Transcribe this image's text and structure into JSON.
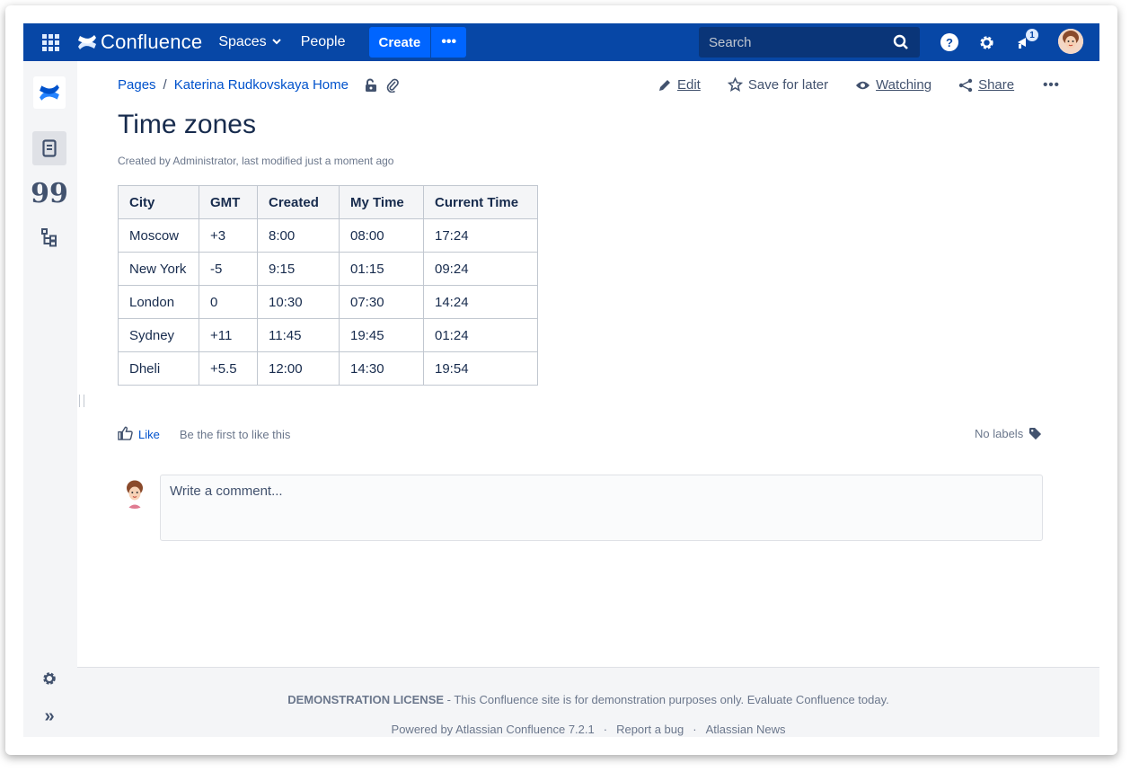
{
  "header": {
    "app_name": "Confluence",
    "nav": {
      "spaces": "Spaces",
      "people": "People"
    },
    "create_label": "Create",
    "more_label": "•••",
    "search_placeholder": "Search",
    "help_label": "?",
    "notification_count": "1",
    "icons": {
      "apps": "app-switcher-icon",
      "search": "search-icon",
      "help": "help-icon",
      "settings": "gear-icon",
      "notifications": "megaphone-icon"
    }
  },
  "sidebar": {
    "icons": [
      "confluence-logo-icon",
      "pages-icon",
      "blog-quote-icon",
      "page-tree-icon",
      "space-settings-icon",
      "expand-icon"
    ],
    "expand_label": "»",
    "quote_label": "99"
  },
  "breadcrumb": {
    "root": "Pages",
    "separator": "/",
    "current": "Katerina Rudkovskaya Home"
  },
  "actions": {
    "edit": "Edit",
    "save_for_later": "Save for later",
    "watching": "Watching",
    "share": "Share",
    "more": "•••"
  },
  "page": {
    "title": "Time zones",
    "byline": "Created by Administrator, last modified just a moment ago"
  },
  "table": {
    "headers": [
      "City",
      "GMT",
      "Created",
      "My Time",
      "Current Time"
    ],
    "rows": [
      [
        "Moscow",
        "+3",
        "8:00",
        "08:00",
        "17:24"
      ],
      [
        "New York",
        "-5",
        "9:15",
        "01:15",
        "09:24"
      ],
      [
        "London",
        "0",
        "10:30",
        "07:30",
        "14:24"
      ],
      [
        "Sydney",
        "+11",
        "11:45",
        "19:45",
        "01:24"
      ],
      [
        "Dheli",
        "+5.5",
        "12:00",
        "14:30",
        "19:54"
      ]
    ]
  },
  "likes": {
    "like_label": "Like",
    "like_text": "Be the first to like this",
    "labels_text": "No labels"
  },
  "comment": {
    "placeholder": "Write a comment..."
  },
  "footer": {
    "license_bold": "DEMONSTRATION LICENSE",
    "license_text": " - This Confluence site is for demonstration purposes only. Evaluate Confluence today.",
    "powered": "Powered by Atlassian Confluence 7.2.1",
    "report_bug": "Report a bug",
    "news": "Atlassian News",
    "sep": "·"
  },
  "colors": {
    "header_bg": "#0747a6",
    "create_bg": "#0065ff",
    "link": "#0052cc",
    "text": "#172b4d"
  }
}
